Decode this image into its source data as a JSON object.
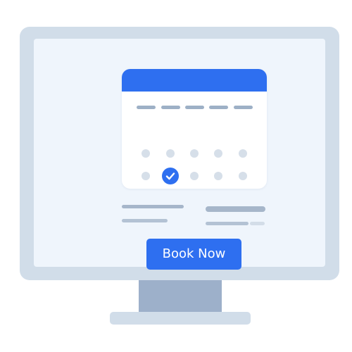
{
  "colors": {
    "accent": "#2e6ff0",
    "monitor_frame": "#d1dde9",
    "screen_background": "#eff5fc",
    "stand": "#9db0ca",
    "placeholder_gray": "#b3c2d4"
  },
  "calendar": {
    "selected_day_icon": "check-icon"
  },
  "booking": {
    "button_label": "Book Now"
  }
}
